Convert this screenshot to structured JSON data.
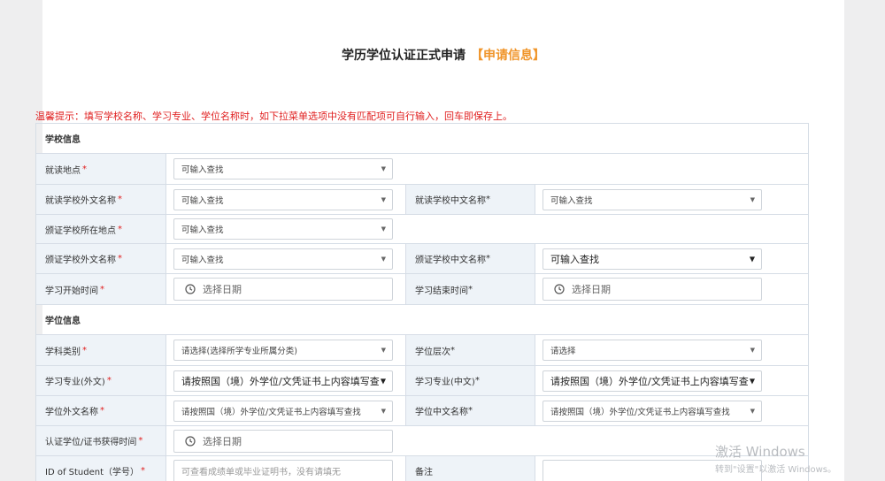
{
  "header": {
    "title": "学历学位认证正式申请",
    "tag": "【申请信息】"
  },
  "tip": "温馨提示：填写学校名称、学习专业、学位名称时，如下拉菜单选项中没有匹配项可自行输入，回车即保存上。",
  "sections": {
    "school": "学校信息",
    "degree": "学位信息"
  },
  "fields": {
    "study_location": {
      "label": "就读地点",
      "req": "*",
      "value": "可输入查找"
    },
    "school_foreign_name": {
      "label": "就读学校外文名称",
      "req": "*",
      "value": "可输入查找"
    },
    "school_chinese_name": {
      "label": "就读学校中文名称",
      "req": " *",
      "value": "可输入查找"
    },
    "cert_school_location": {
      "label": "颁证学校所在地点",
      "req": " *",
      "value": "可输入查找"
    },
    "cert_school_foreign_name": {
      "label": "颁证学校外文名称",
      "req": " *",
      "value": "可输入查找"
    },
    "cert_school_chinese_name": {
      "label": "颁证学校中文名称",
      "req": " *",
      "value": "可输入查找"
    },
    "study_start": {
      "label": "学习开始时间",
      "req": " *",
      "placeholder": "选择日期"
    },
    "study_end": {
      "label": "学习结束时间",
      "req": " *",
      "placeholder": "选择日期"
    },
    "subject_category": {
      "label": "学科类别",
      "req": " *",
      "value": "请选择(选择所学专业所属分类)"
    },
    "degree_level": {
      "label": "学位层次",
      "req": " *",
      "value": "请选择"
    },
    "major_foreign": {
      "label": "学习专业(外文)",
      "req": "*",
      "value": "请按照国（境）外学位/文凭证书上内容填写查"
    },
    "major_chinese": {
      "label": "学习专业(中文)",
      "req": " *",
      "value": "请按照国（境）外学位/文凭证书上内容填写查"
    },
    "degree_foreign_name": {
      "label": "学位外文名称",
      "req": " *",
      "value": "请按照国（境）外学位/文凭证书上内容填写查找"
    },
    "degree_chinese_name": {
      "label": "学位中文名称",
      "req": "*",
      "value": "请按照国（境）外学位/文凭证书上内容填写查找"
    },
    "degree_obtained_time": {
      "label": "认证学位/证书获得时间",
      "req": "*",
      "placeholder": "选择日期"
    },
    "student_id": {
      "label": "ID of Student（学号）",
      "req": " *",
      "placeholder": "可查看成绩单或毕业证明书，没有请填无"
    },
    "remarks": {
      "label": "备注",
      "value": ""
    }
  },
  "watermark": {
    "line1": "激活 Windows",
    "line2": "转到\"设置\"以激活 Windows。"
  }
}
